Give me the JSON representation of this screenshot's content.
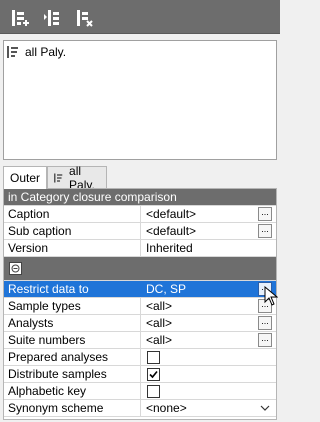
{
  "toolbar": {
    "buttons": [
      {
        "name": "add-icon"
      },
      {
        "name": "move-icon"
      },
      {
        "name": "remove-icon"
      }
    ]
  },
  "list": {
    "items": [
      {
        "label": "all Paly."
      }
    ]
  },
  "tabs": [
    {
      "label": "Outer",
      "active": true
    },
    {
      "label": "all Paly.",
      "active": false
    }
  ],
  "grid": {
    "section_title": "in Category closure comparison",
    "rows": [
      {
        "key": "Caption",
        "value": "<default>",
        "ellipsis": "..."
      },
      {
        "key": "Sub caption",
        "value": "<default>",
        "ellipsis": "..."
      },
      {
        "key": "Version",
        "value": "Inherited"
      },
      {
        "key": "Restrict data to",
        "value": "DC, SP",
        "ellipsis": "...",
        "selected": true
      },
      {
        "key": "Sample types",
        "value": "<all>",
        "ellipsis": "..."
      },
      {
        "key": "Analysts",
        "value": "<all>",
        "ellipsis": "..."
      },
      {
        "key": "Suite numbers",
        "value": "<all>",
        "ellipsis": "..."
      },
      {
        "key": "Prepared analyses",
        "checked": false
      },
      {
        "key": "Distribute samples",
        "checked": true
      },
      {
        "key": "Alphabetic key",
        "checked": false
      },
      {
        "key": "Synonym scheme",
        "value": "<none>"
      }
    ]
  },
  "colors": {
    "toolbar_bg": "#6d6d6d",
    "selection": "#1f74d8"
  }
}
